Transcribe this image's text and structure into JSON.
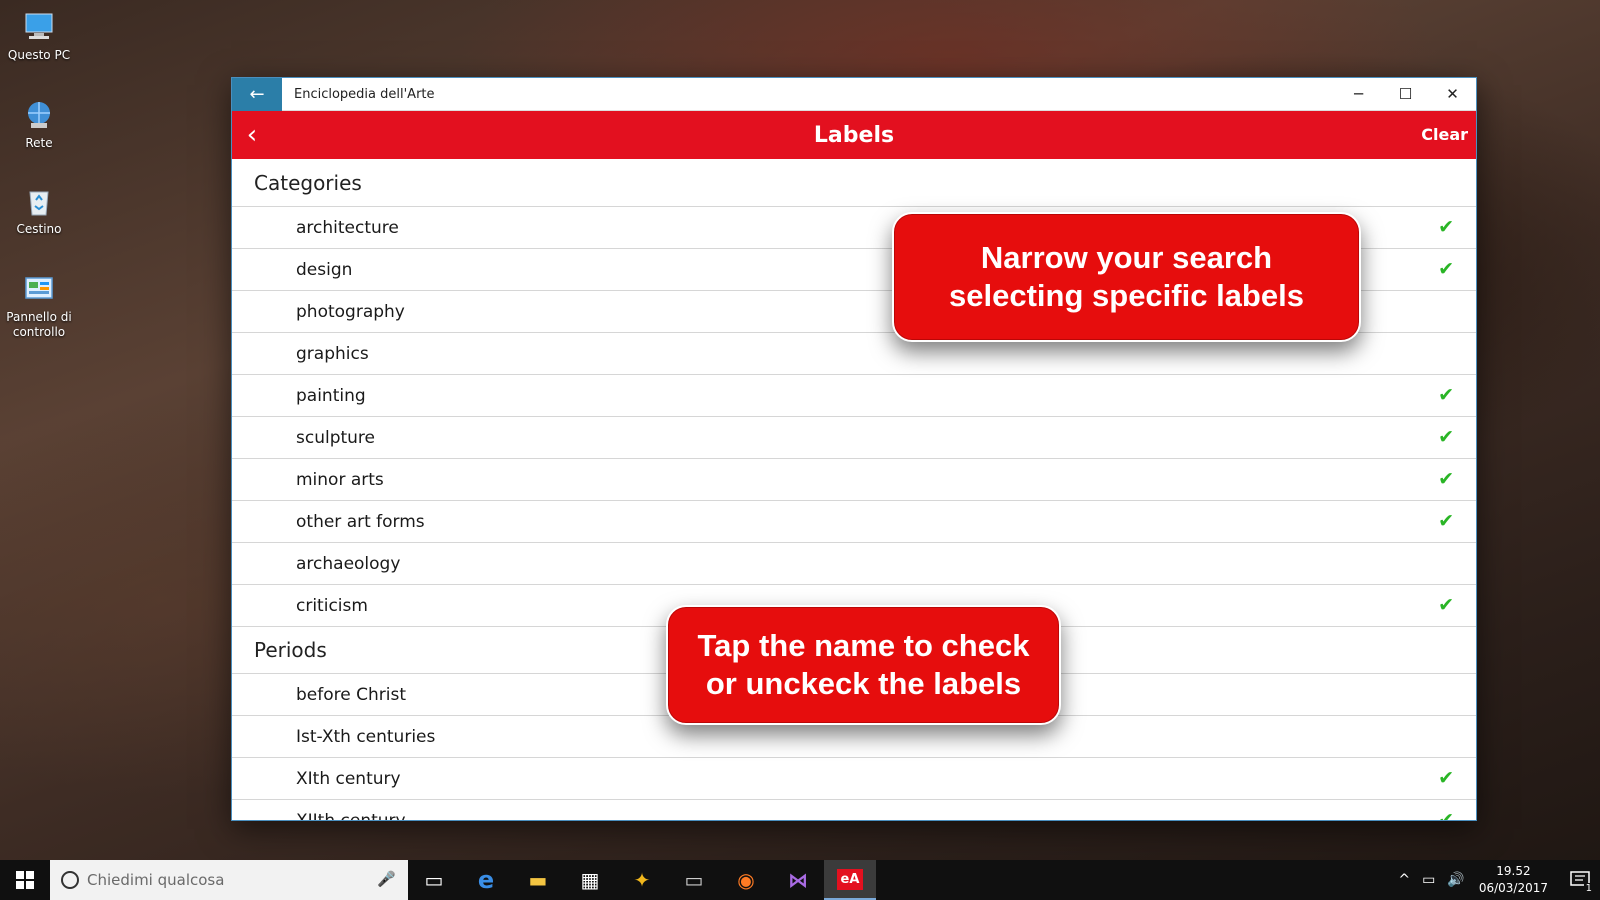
{
  "desktop": {
    "icons": [
      {
        "label": "Questo PC",
        "icon": "computer-icon"
      },
      {
        "label": "Rete",
        "icon": "network-icon"
      },
      {
        "label": "Cestino",
        "icon": "recycle-bin-icon"
      },
      {
        "label": "Pannello di controllo",
        "icon": "control-panel-icon"
      }
    ]
  },
  "window": {
    "title": "Enciclopedia dell'Arte",
    "back_glyph": "←",
    "minimize_glyph": "─",
    "maximize_glyph": "☐",
    "close_glyph": "✕"
  },
  "appbar": {
    "back_glyph": "‹",
    "title": "Labels",
    "clear_label": "Clear",
    "color": "#e3101f"
  },
  "sections": [
    {
      "header": "Categories",
      "items": [
        {
          "label": "architecture",
          "checked": true
        },
        {
          "label": "design",
          "checked": true
        },
        {
          "label": "photography",
          "checked": false
        },
        {
          "label": "graphics",
          "checked": false
        },
        {
          "label": "painting",
          "checked": true
        },
        {
          "label": "sculpture",
          "checked": true
        },
        {
          "label": "minor arts",
          "checked": true
        },
        {
          "label": "other art forms",
          "checked": true
        },
        {
          "label": "archaeology",
          "checked": false
        },
        {
          "label": "criticism",
          "checked": true
        }
      ]
    },
    {
      "header": "Periods",
      "items": [
        {
          "label": "before Christ",
          "checked": false
        },
        {
          "label": "Ist-Xth centuries",
          "checked": false
        },
        {
          "label": "XIth century",
          "checked": true
        },
        {
          "label": "XIIth century",
          "checked": true
        }
      ]
    }
  ],
  "check_glyph": "✔",
  "check_color": "#2ab526",
  "callouts": {
    "top": "Narrow your search selecting specific labels",
    "bottom": "Tap the name to check or unckeck the labels"
  },
  "taskbar": {
    "search_placeholder": "Chiedimi qualcosa",
    "apps": [
      {
        "name": "task-view",
        "glyph": "▭"
      },
      {
        "name": "edge",
        "glyph": "e"
      },
      {
        "name": "file-explorer",
        "glyph": "▬"
      },
      {
        "name": "store",
        "glyph": "▦"
      },
      {
        "name": "app-yellow",
        "glyph": "✦"
      },
      {
        "name": "terminal",
        "glyph": "▭"
      },
      {
        "name": "firefox",
        "glyph": "◉"
      },
      {
        "name": "visual-studio",
        "glyph": "⋈"
      },
      {
        "name": "enciclopedia-arte",
        "glyph": "eA"
      }
    ],
    "time": "19.52",
    "date": "06/03/2017",
    "notification_count": "1"
  }
}
